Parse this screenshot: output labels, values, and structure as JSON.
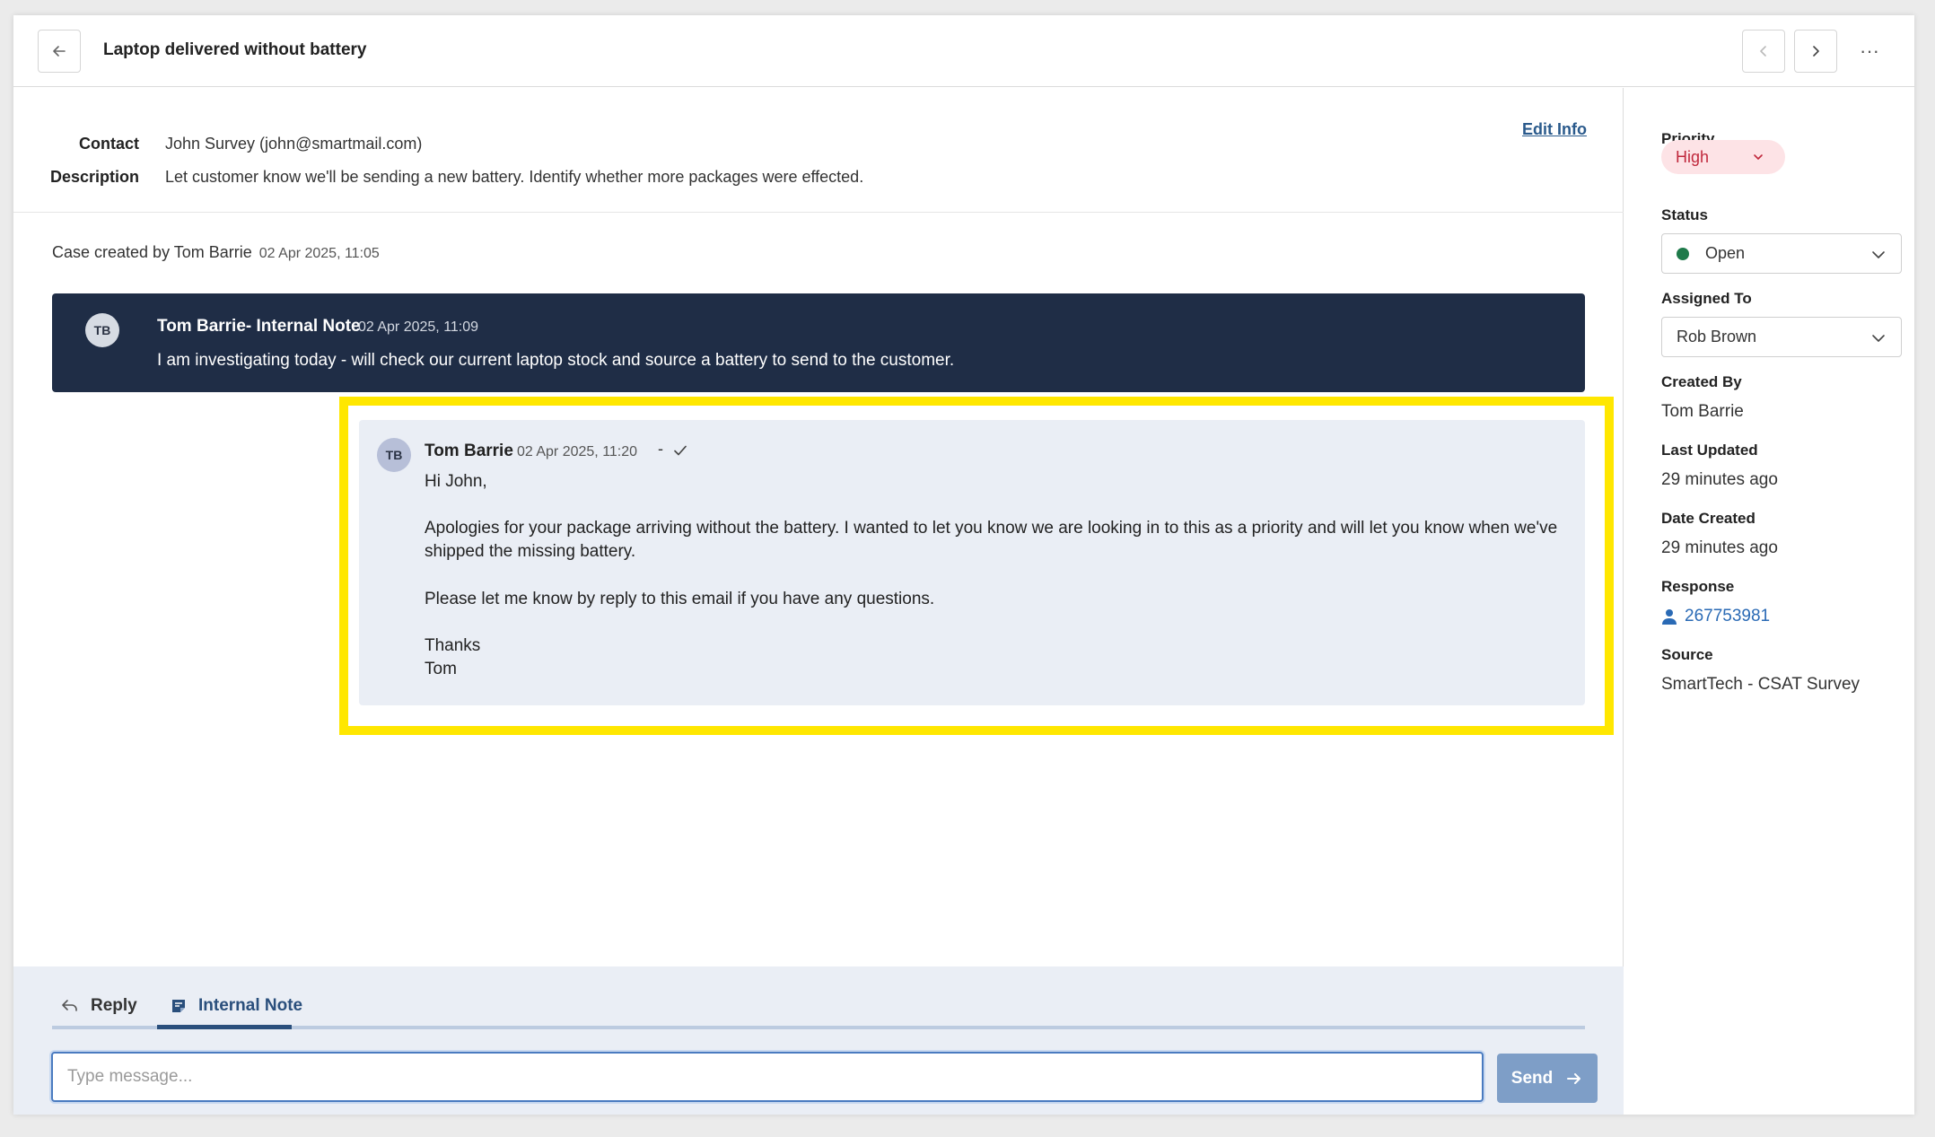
{
  "header": {
    "title": "Laptop delivered without battery"
  },
  "info": {
    "contact_label": "Contact",
    "contact_value": "John Survey (john@smartmail.com)",
    "description_label": "Description",
    "description_value": "Let customer know we'll be sending a new battery. Identify whether more packages were effected.",
    "edit_label": "Edit Info"
  },
  "timeline": {
    "case_created_text": "Case created by Tom Barrie",
    "case_created_ts": "02 Apr 2025, 11:05",
    "internal_note": {
      "initials": "TB",
      "author": "Tom Barrie- Internal Note",
      "timestamp": "02 Apr 2025, 11:09",
      "body": "I am investigating today - will check our current laptop stock and source a battery to send to the customer."
    },
    "email": {
      "initials": "TB",
      "author": "Tom Barrie",
      "timestamp": "02 Apr 2025, 11:20",
      "separator": "-",
      "greeting": "Hi John,",
      "para1_line1": "Apologies for your package arriving without the battery. I wanted to let you know we are looking in to this as a priority and will let you know when we've",
      "para1_line2": "shipped the missing battery.",
      "para2": "Please let me know by reply to this email if you have any questions.",
      "signoff": "Thanks",
      "signature": "Tom"
    }
  },
  "composer": {
    "tab_reply": "Reply",
    "tab_note": "Internal Note",
    "placeholder": "Type message...",
    "send_label": "Send"
  },
  "sidebar": {
    "priority_label": "Priority",
    "priority_value": "High",
    "status_label": "Status",
    "status_value": "Open",
    "assigned_label": "Assigned To",
    "assigned_value": "Rob Brown",
    "created_by_label": "Created By",
    "created_by_value": "Tom Barrie",
    "last_updated_label": "Last Updated",
    "last_updated_value": "29 minutes ago",
    "date_created_label": "Date Created",
    "date_created_value": "29 minutes ago",
    "response_label": "Response",
    "response_value": "267753981",
    "source_label": "Source",
    "source_value": "SmartTech - CSAT Survey"
  },
  "colors": {
    "note_bg": "#1f2d46",
    "highlight": "#ffe700",
    "priority_text": "#c0283c",
    "status_dot": "#1e7a4a",
    "accent": "#2a4f7c"
  },
  "icons": [
    "arrow-left-icon",
    "chevron-left-icon",
    "chevron-right-icon",
    "more-icon",
    "check-icon",
    "reply-icon",
    "note-icon",
    "arrow-right-icon",
    "chevron-down-icon",
    "user-icon"
  ]
}
